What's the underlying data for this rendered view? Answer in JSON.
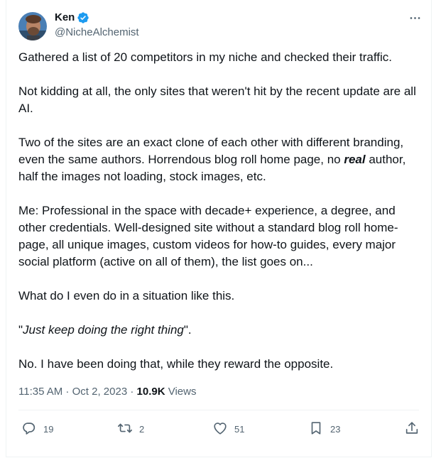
{
  "author": {
    "name": "Ken",
    "handle": "@NicheAlchemist",
    "verified": true
  },
  "colors": {
    "accent": "#1d9bf0",
    "muted": "#536471",
    "text": "#0f1419",
    "divider": "#eff3f4"
  },
  "post": {
    "p1": "Gathered a list of 20 competitors in my niche and checked their traffic.",
    "p2": "Not kidding at all, the only sites that weren't hit by the recent update are all AI.",
    "p3_before": "Two of the sites are an exact clone of each other with different branding, even the same authors. Horrendous blog roll home page, no ",
    "p3_emphasis": "real",
    "p3_after": " author, half the images not loading, stock images, etc.",
    "p4": "Me: Professional in the space with decade+ experience, a degree, and other credentials. Well-designed site without a standard blog roll home-page, all unique images, custom videos for how-to guides, every major social platform (active on all of them), the list goes on...",
    "p5": "What do I even do in a situation like this.",
    "p6_open": "\"",
    "p6_quote": "Just keep doing the right thing",
    "p6_close": "\".",
    "p7": "No. I have been doing that, while they reward the opposite."
  },
  "meta": {
    "time": "11:35 AM",
    "separator": " · ",
    "date": "Oct 2, 2023",
    "views_count": "10.9K",
    "views_label": " Views"
  },
  "actions": {
    "replies": "19",
    "reposts": "2",
    "likes": "51",
    "bookmarks": "23"
  },
  "icons": [
    "verified-badge-icon",
    "more-icon",
    "reply-icon",
    "repost-icon",
    "like-icon",
    "bookmark-icon",
    "share-icon"
  ]
}
